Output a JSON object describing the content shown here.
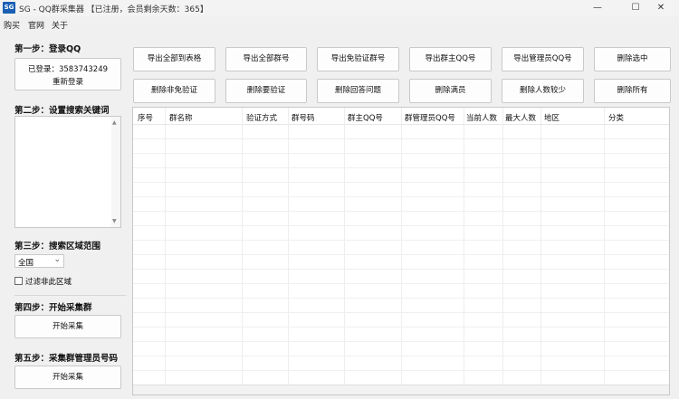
{
  "window": {
    "icon_text": "SG",
    "title": "SG - QQ群采集器 【已注册，会员剩余天数：365】",
    "minimize": "—",
    "maximize": "☐",
    "close": "✕"
  },
  "menu": [
    "购买",
    "官网",
    "关于"
  ],
  "steps": {
    "step1": {
      "title": "第一步：登录QQ",
      "login_status": "已登录：3583743249",
      "relogin": "重新登录"
    },
    "step2": {
      "title": "第二步：设置搜索关键词",
      "keywords": ""
    },
    "step3": {
      "title": "第三步：搜索区域范围",
      "region": "全国",
      "filter_label": "过滤非此区域",
      "filter_checked": false
    },
    "step4": {
      "title": "第四步：开始采集群",
      "button": "开始采集"
    },
    "step5": {
      "title": "第五步：采集群管理员号码",
      "button": "开始采集"
    }
  },
  "toolbar": {
    "row1": [
      "导出全部到表格",
      "导出全部群号",
      "导出免验证群号",
      "导出群主QQ号",
      "导出管理员QQ号",
      "删除选中"
    ],
    "row2": [
      "删除非免验证",
      "删除要验证",
      "删除回答问题",
      "删除满员",
      "删除人数较少",
      "删除所有"
    ]
  },
  "table": {
    "columns": [
      "序号",
      "群名称",
      "验证方式",
      "群号码",
      "群主QQ号",
      "群管理员QQ号",
      "当前人数",
      "最大人数",
      "地区",
      "分类"
    ],
    "rows": []
  }
}
